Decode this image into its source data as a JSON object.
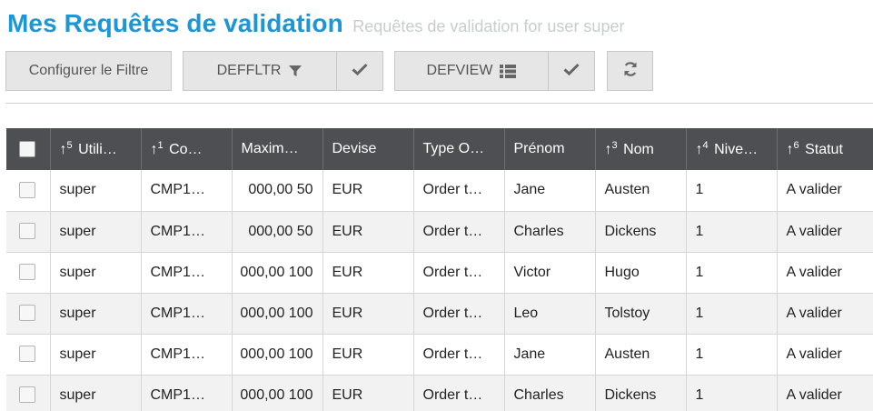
{
  "header": {
    "title": "Mes Requêtes de validation",
    "subtitle": "Requêtes de validation for user super"
  },
  "toolbar": {
    "configure_label": "Configurer le Filtre",
    "filter_label": "DEFFLTR",
    "view_label": "DEFVIEW",
    "icons": {
      "filter": "filter-icon",
      "apply": "check-icon",
      "view": "list-icon",
      "refresh": "refresh-icon"
    }
  },
  "table": {
    "columns": [
      {
        "label": "Utili…",
        "sort": "5"
      },
      {
        "label": "Co…",
        "sort": "1"
      },
      {
        "label": "Maxim…",
        "sort": ""
      },
      {
        "label": "Devise",
        "sort": ""
      },
      {
        "label": "Type O…",
        "sort": ""
      },
      {
        "label": "Prénom",
        "sort": ""
      },
      {
        "label": "Nom",
        "sort": "3"
      },
      {
        "label": "Nive…",
        "sort": "4"
      },
      {
        "label": "Statut",
        "sort": "6"
      }
    ],
    "sort_arrow": "↑",
    "rows": [
      {
        "user": "super",
        "code": "CMP1…",
        "max": "50 000,00",
        "currency": "EUR",
        "type": "Order t…",
        "first": "Jane",
        "last": "Austen",
        "level": "1",
        "status": "A valider"
      },
      {
        "user": "super",
        "code": "CMP1…",
        "max": "50 000,00",
        "currency": "EUR",
        "type": "Order t…",
        "first": "Charles",
        "last": "Dickens",
        "level": "1",
        "status": "A valider"
      },
      {
        "user": "super",
        "code": "CMP1…",
        "max": "100 000,00",
        "currency": "EUR",
        "type": "Order t…",
        "first": "Victor",
        "last": "Hugo",
        "level": "1",
        "status": "A valider"
      },
      {
        "user": "super",
        "code": "CMP1…",
        "max": "100 000,00",
        "currency": "EUR",
        "type": "Order t…",
        "first": "Leo",
        "last": "Tolstoy",
        "level": "1",
        "status": "A valider"
      },
      {
        "user": "super",
        "code": "CMP1…",
        "max": "100 000,00",
        "currency": "EUR",
        "type": "Order t…",
        "first": "Jane",
        "last": "Austen",
        "level": "1",
        "status": "A valider"
      },
      {
        "user": "super",
        "code": "CMP1…",
        "max": "100 000,00",
        "currency": "EUR",
        "type": "Order t…",
        "first": "Charles",
        "last": "Dickens",
        "level": "1",
        "status": "A valider"
      }
    ]
  },
  "colors": {
    "title": "#1e95d4",
    "header_bg": "#4d4f53",
    "button_bg": "#e6e6e6"
  }
}
